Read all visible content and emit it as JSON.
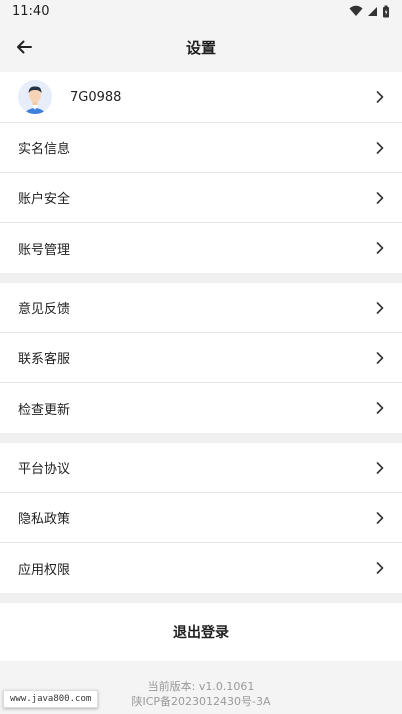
{
  "status_bar": {
    "time": "11:40"
  },
  "header": {
    "title": "设置"
  },
  "profile": {
    "username": "7G0988"
  },
  "group1": [
    {
      "label": "实名信息"
    },
    {
      "label": "账户安全"
    },
    {
      "label": "账号管理"
    }
  ],
  "group2": [
    {
      "label": "意见反馈"
    },
    {
      "label": "联系客服"
    },
    {
      "label": "检查更新"
    }
  ],
  "group3": [
    {
      "label": "平台协议"
    },
    {
      "label": "隐私政策"
    },
    {
      "label": "应用权限"
    }
  ],
  "logout": {
    "label": "退出登录"
  },
  "footer": {
    "version": "当前版本: v1.0.1061",
    "icp": "陕ICP备2023012430号-3A"
  },
  "watermark": {
    "text": "www.java800.com"
  },
  "colors": {
    "background": "#f4f4f4",
    "card": "#ffffff",
    "text": "#1f1f1f",
    "muted": "#9a9a9a"
  }
}
